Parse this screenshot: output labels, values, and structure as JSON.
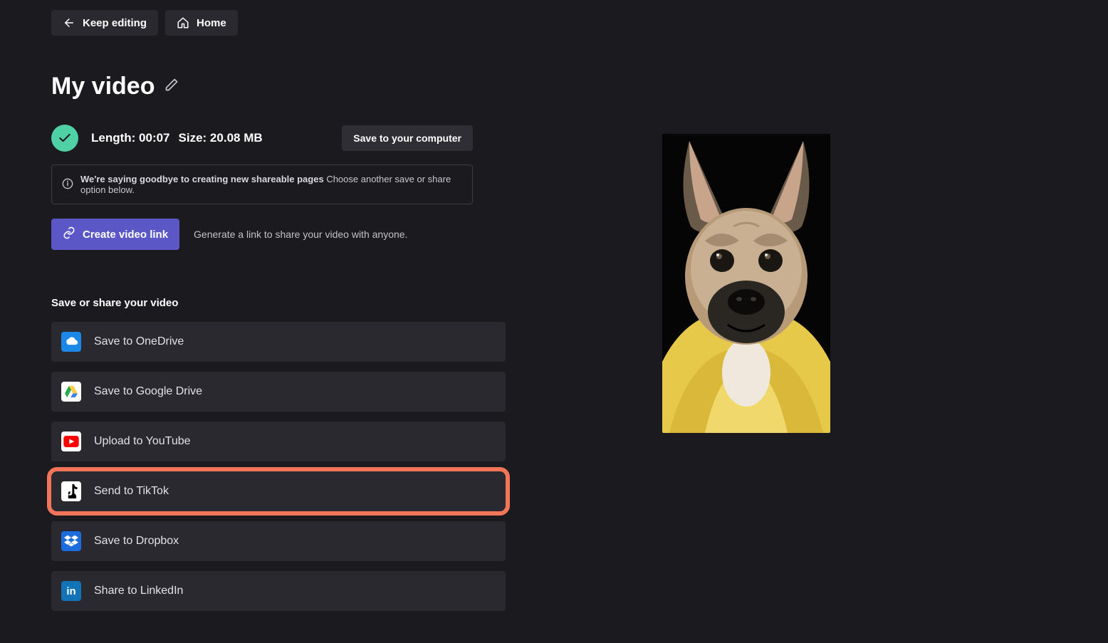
{
  "header": {
    "keep_editing_label": "Keep editing",
    "home_label": "Home"
  },
  "title": "My video",
  "info": {
    "length_label": "Length: 00:07",
    "size_label": "Size: 20.08 MB",
    "save_computer_label": "Save to your computer"
  },
  "notice": {
    "bold": "We're saying goodbye to creating new shareable pages",
    "rest": "Choose another save or share option below."
  },
  "create_link": {
    "button_label": "Create video link",
    "description": "Generate a link to share your video with anyone."
  },
  "section_heading": "Save or share your video",
  "share_options": [
    {
      "id": "onedrive",
      "label": "Save to OneDrive",
      "highlight": false
    },
    {
      "id": "googledrive",
      "label": "Save to Google Drive",
      "highlight": false
    },
    {
      "id": "youtube",
      "label": "Upload to YouTube",
      "highlight": false
    },
    {
      "id": "tiktok",
      "label": "Send to TikTok",
      "highlight": true
    },
    {
      "id": "dropbox",
      "label": "Save to Dropbox",
      "highlight": false
    },
    {
      "id": "linkedin",
      "label": "Share to LinkedIn",
      "highlight": false
    }
  ],
  "preview": {
    "description": "French bulldog in yellow hoodie"
  }
}
